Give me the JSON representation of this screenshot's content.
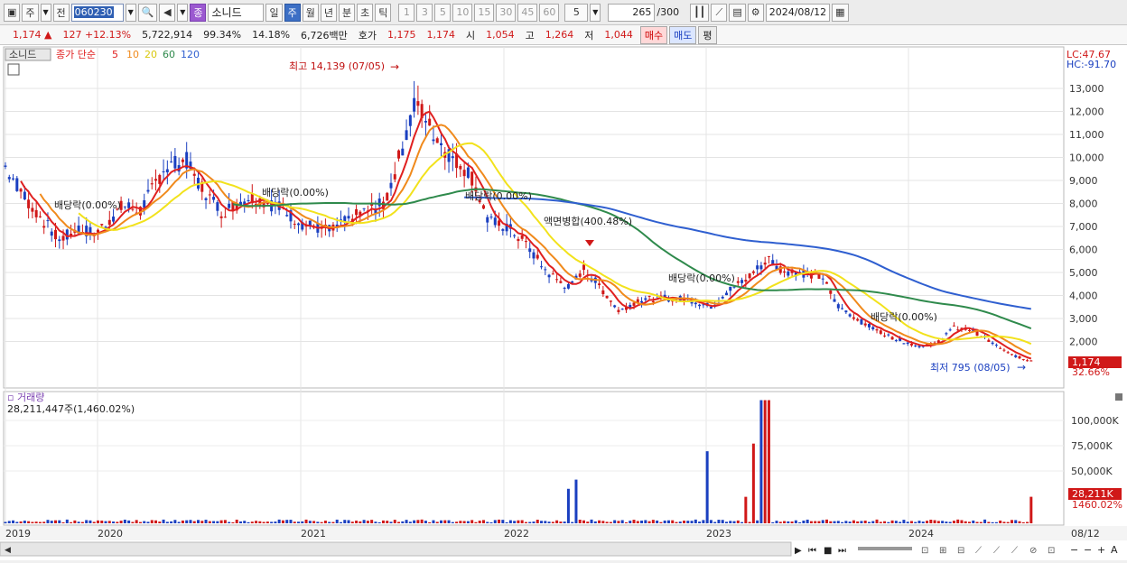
{
  "toolbar": {
    "period_type": "주",
    "prev_label": "전",
    "stock_code": "060230",
    "stock_badge": "종",
    "stock_name": "소니드",
    "intervals": [
      "일",
      "주",
      "월",
      "년",
      "분",
      "초",
      "틱"
    ],
    "active_interval": "주",
    "numbers": [
      "1",
      "3",
      "5",
      "10",
      "15",
      "30",
      "45",
      "60"
    ],
    "count_value": "5",
    "range_value": "265",
    "range_total": "/300",
    "date": "2024/08/12"
  },
  "info": {
    "price": "1,174",
    "change": "127",
    "change_pct": "+12.13%",
    "volume": "5,722,914",
    "vol_ratio": "99.34%",
    "turnover": "14.18%",
    "amount": "6,726백만",
    "quote_label": "호가",
    "ask": "1,175",
    "bid": "1,174",
    "open_label": "시",
    "open": "1,054",
    "high_label": "고",
    "high": "1,264",
    "low_label": "저",
    "low": "1,044",
    "buy_label": "매수",
    "sell_label": "매도",
    "eval_label": "평"
  },
  "chart": {
    "stock_tag": "소니드",
    "ma_title": "종가 단순",
    "ma_periods": [
      "5",
      "10",
      "20",
      "60",
      "120"
    ],
    "ma_colors": [
      "#e02020",
      "#f08a1c",
      "#f2e21c",
      "#2f8a4c",
      "#2f5fd0"
    ],
    "lc": "LC:47.67",
    "hc": "HC:-91.70",
    "price_ticks": [
      "13,000",
      "12,000",
      "11,000",
      "10,000",
      "9,000",
      "8,000",
      "7,000",
      "6,000",
      "5,000",
      "4,000",
      "3,000",
      "2,000"
    ],
    "current_price_tag": "1,174",
    "current_pct_tag": "32.66%",
    "annotations": {
      "high": "최고 14,139 (07/05)",
      "low": "최저 795 (08/05)",
      "div1": "배당락(0.00%)",
      "div2": "배당락(0.00%)",
      "div3": "배당락(0.00%)",
      "div4": "배당락(0.00%)",
      "div5": "배당락(0.00%)",
      "merge": "액면병합(400.48%)"
    },
    "volume_title": "거래량",
    "volume_summary": "28,211,447주(1,460.02%)",
    "volume_ticks": [
      "100,000K",
      "75,000K",
      "50,000K"
    ],
    "volume_tag": "28,211K",
    "volume_pct_tag": "1460.02%",
    "x_labels": [
      "2019",
      "2020",
      "2021",
      "2022",
      "2023",
      "2024"
    ],
    "x_end_label": "08/12"
  },
  "chart_data": {
    "type": "candlestick-weekly",
    "symbol": "소니드 (060230)",
    "y_range_price": [
      795,
      14139
    ],
    "highest": {
      "value": 14139,
      "date": "07/05"
    },
    "lowest": {
      "value": 795,
      "date": "08/05"
    },
    "last_close": 1174,
    "x": [
      "2019",
      "2020",
      "2021",
      "2022",
      "2023",
      "2024"
    ],
    "ma_lines": [
      "5",
      "10",
      "20",
      "60",
      "120"
    ]
  }
}
